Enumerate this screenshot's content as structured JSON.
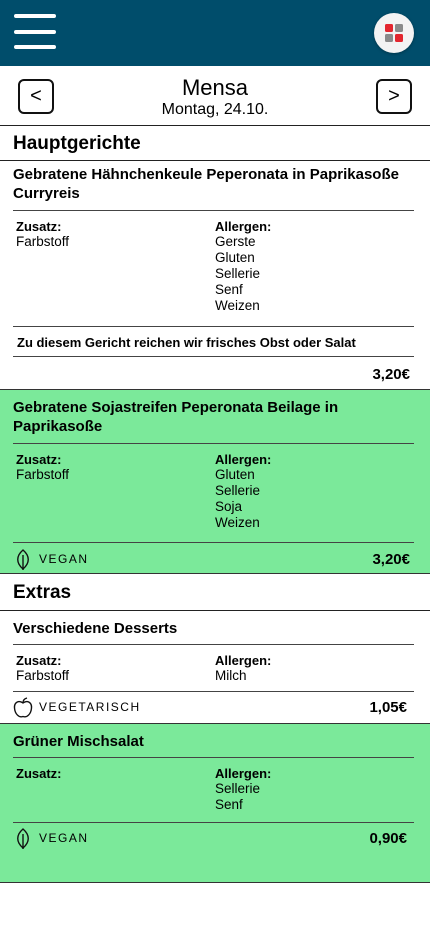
{
  "header": {
    "menu_icon": "hamburger-menu-icon",
    "app_icon": "app-grid-icon"
  },
  "datebar": {
    "prev_label": "<",
    "next_label": ">",
    "title": "Mensa",
    "date": "Montag, 24.10."
  },
  "sections": {
    "main_title": "Hauptgerichte",
    "extras_title": "Extras"
  },
  "labels": {
    "additives": "Zusatz:",
    "allergens": "Allergen:"
  },
  "dishes": [
    {
      "name": "Gebratene Hähnchenkeule Peperonata in Paprikasoße Curryreis",
      "additives": [
        "Farbstoff"
      ],
      "allergens": [
        "Gerste",
        "Gluten",
        "Sellerie",
        "Senf",
        "Weizen"
      ],
      "note": "Zu diesem Gericht reichen wir frisches Obst oder Salat",
      "price": "3,20€"
    },
    {
      "name": "Gebratene Sojastreifen Peperonata Beilage in Paprikasoße",
      "additives": [
        "Farbstoff"
      ],
      "allergens": [
        "Gluten",
        "Sellerie",
        "Soja",
        "Weizen"
      ],
      "tag": "VEGAN",
      "tag_icon": "leaf-icon",
      "price": "3,20€"
    },
    {
      "name": "Verschiedene Desserts",
      "additives": [
        "Farbstoff"
      ],
      "allergens": [
        "Milch"
      ],
      "tag": "VEGETARISCH",
      "tag_icon": "apple-icon",
      "price": "1,05€"
    },
    {
      "name": "Grüner Mischsalat",
      "additives": [],
      "allergens": [
        "Sellerie",
        "Senf"
      ],
      "tag": "VEGAN",
      "tag_icon": "leaf-icon",
      "price": "0,90€"
    }
  ],
  "colors": {
    "header_bg": "#004d6b",
    "vegan_bg": "#7be99a",
    "icon_red": "#e3262e",
    "icon_gray": "#8a8a8a"
  }
}
